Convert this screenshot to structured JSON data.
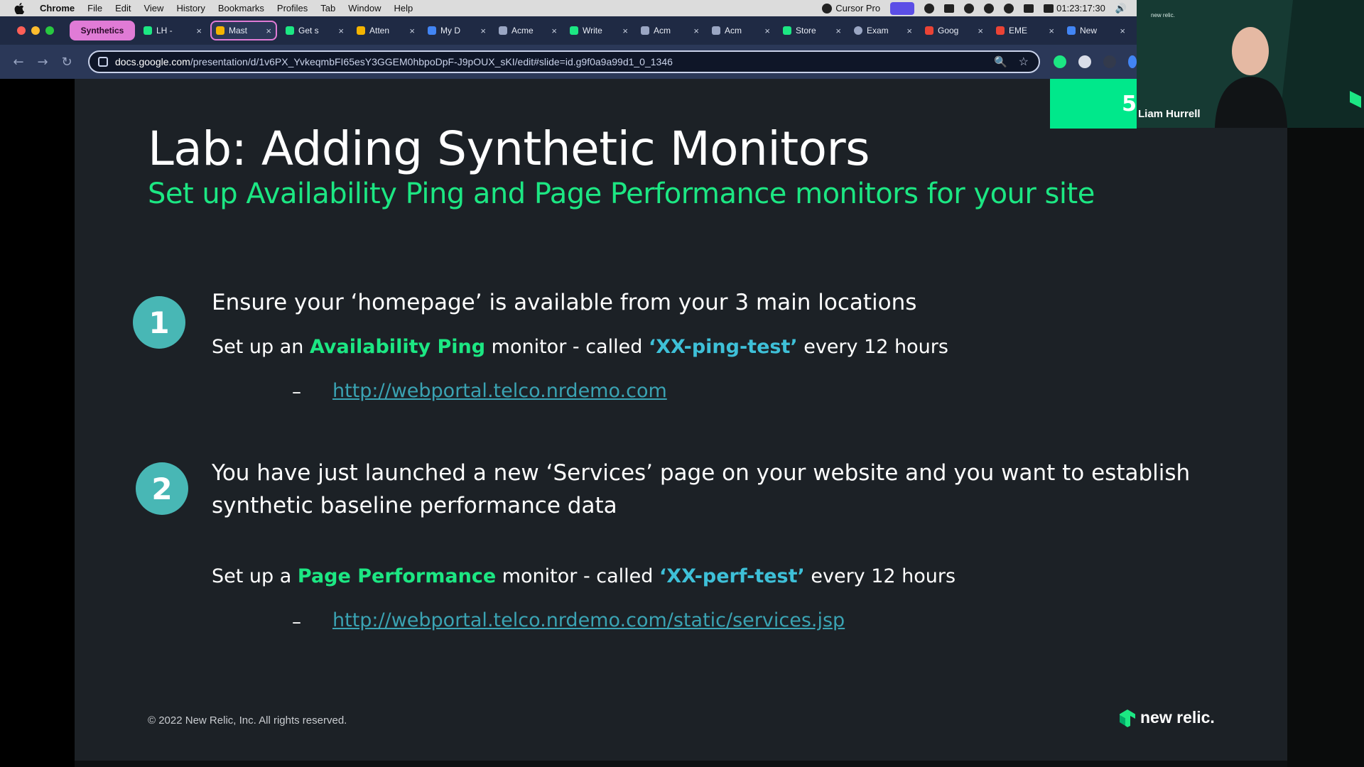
{
  "menubar": {
    "app": "Chrome",
    "items": [
      "File",
      "Edit",
      "View",
      "History",
      "Bookmarks",
      "Profiles",
      "Tab",
      "Window",
      "Help"
    ],
    "status": {
      "cursor_label": "Cursor Pro",
      "battery_time": "01:23:17:30"
    }
  },
  "tabs": {
    "group_label": "Synthetics",
    "items": [
      {
        "label": "LH -",
        "icon": "newrelic-icon",
        "color": "#1ce783"
      },
      {
        "label": "Mast",
        "icon": "slides-icon",
        "color": "#f4b400",
        "active": true
      },
      {
        "label": "Get s",
        "icon": "newrelic-icon",
        "color": "#1ce783"
      },
      {
        "label": "Atten",
        "icon": "slides-icon",
        "color": "#f4b400"
      },
      {
        "label": "My D",
        "icon": "drive-icon",
        "color": "#4285f4"
      },
      {
        "label": "Acme",
        "icon": "doc-icon",
        "color": "#9aa6c3"
      },
      {
        "label": "Write",
        "icon": "newrelic-icon",
        "color": "#1ce783"
      },
      {
        "label": "Acm",
        "icon": "doc-icon",
        "color": "#9aa6c3"
      },
      {
        "label": "Acm",
        "icon": "doc-icon",
        "color": "#9aa6c3"
      },
      {
        "label": "Store",
        "icon": "newrelic-icon",
        "color": "#1ce783"
      },
      {
        "label": "Exam",
        "icon": "globe-icon",
        "color": "#9aa6c3"
      },
      {
        "label": "Goog",
        "icon": "google-icon",
        "color": "#ea4335"
      },
      {
        "label": "EME",
        "icon": "gmail-icon",
        "color": "#ea4335"
      },
      {
        "label": "New",
        "icon": "calendar-icon",
        "color": "#4285f4"
      }
    ]
  },
  "address_bar": {
    "host": "docs.google.com",
    "path": "/presentation/d/1v6PX_YvkeqmbFI65esY3GGEM0hbpoDpF-J9pOUX_sKI/edit#slide=id.g9f0a9a99d1_0_1346"
  },
  "slide": {
    "title": "Lab: Adding Synthetic Monitors",
    "subtitle": "Set up Availability Ping and Page Performance monitors for your site",
    "step1": {
      "number": "1",
      "heading": "Ensure your ‘homepage’ is available from your 3 main locations",
      "instr_pre": "Set up an ",
      "instr_monitor": "Availability Ping",
      "instr_mid": " monitor  - called ",
      "instr_name": "‘XX-ping-test’",
      "instr_post": " every 12 hours",
      "dash": "–",
      "url": "http://webportal.telco.nrdemo.com"
    },
    "step2": {
      "number": "2",
      "heading_line1": "You have just launched a new ‘Services’ page on your website and you want to establish",
      "heading_line2": " synthetic baseline performance data",
      "instr_pre": "Set up a ",
      "instr_monitor": "Page Performance",
      "instr_mid": " monitor  - called ",
      "instr_name": "‘XX-perf-test’",
      "instr_post": " every 12 hours",
      "dash": "–",
      "url": "http://webportal.telco.nrdemo.com/static/services.jsp"
    },
    "copyright": "© 2022 New Relic, Inc. All rights reserved.",
    "logo_text": "new relic.",
    "corner_badge": "5"
  },
  "webcam": {
    "brand": "new relic.",
    "participant_name": "Liam Hurrell"
  },
  "colors": {
    "accent_green": "#1ce783",
    "accent_teal": "#3ec0d8",
    "step_circle": "#48b7b5",
    "slide_bg": "#1c2126",
    "tab_group": "#e07bd6"
  }
}
